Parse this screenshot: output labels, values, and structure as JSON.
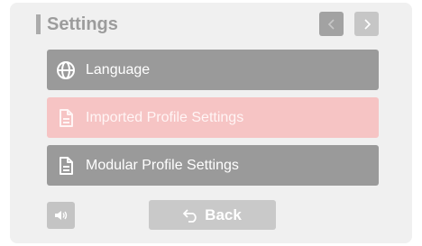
{
  "header": {
    "title": "Settings",
    "prev_icon": "chevron-left-icon",
    "next_icon": "chevron-right-icon"
  },
  "menu": {
    "items": [
      {
        "label": "Language",
        "icon": "globe-icon",
        "selected": false
      },
      {
        "label": "Imported Profile Settings",
        "icon": "document-icon",
        "selected": true
      },
      {
        "label": "Modular Profile Settings",
        "icon": "document-icon",
        "selected": false
      }
    ]
  },
  "footer": {
    "sound_icon": "speaker-icon",
    "back_label": "Back",
    "back_icon": "undo-arrow-icon"
  },
  "colors": {
    "panel_bg": "#f0f0f0",
    "item_bg": "#9a9a9a",
    "selected_bg": "#f6c4c4",
    "button_bg": "#c9c9c9"
  }
}
